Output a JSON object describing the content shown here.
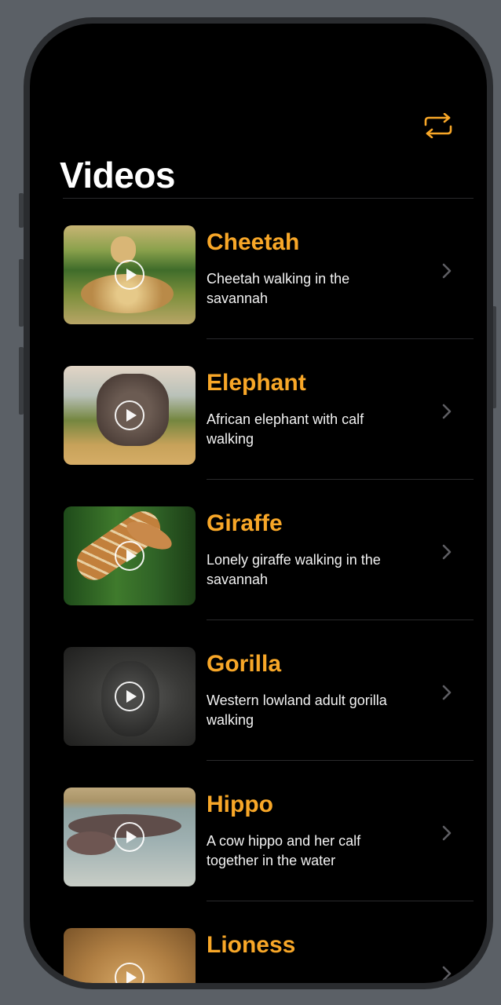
{
  "header": {
    "title": "Videos",
    "refresh_icon": "repeat-icon",
    "accent": "#f8a728"
  },
  "videos": [
    {
      "name": "Cheetah",
      "description": "Cheetah walking in the savannah"
    },
    {
      "name": "Elephant",
      "description": "African elephant with calf walking"
    },
    {
      "name": "Giraffe",
      "description": "Lonely giraffe walking in the savannah"
    },
    {
      "name": "Gorilla",
      "description": "Western lowland adult gorilla walking"
    },
    {
      "name": "Hippo",
      "description": "A cow hippo and her calf together in the water"
    },
    {
      "name": "Lioness",
      "description": ""
    }
  ]
}
